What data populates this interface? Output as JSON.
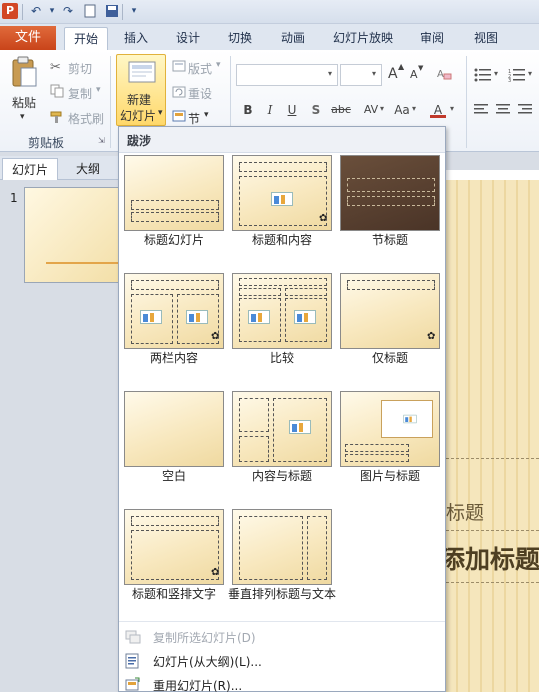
{
  "quick_access": {
    "app_icon": "P",
    "undo_icon": "undo-icon",
    "redo_icon": "redo-icon",
    "new_icon": "new-document-icon",
    "save_icon": "save-icon"
  },
  "ribbon_tabs": {
    "file": "文件",
    "tabs": [
      "开始",
      "插入",
      "设计",
      "切换",
      "动画",
      "幻灯片放映",
      "审阅",
      "视图"
    ],
    "active_index": 0
  },
  "clipboard": {
    "paste": "粘贴",
    "cut": "剪切",
    "copy": "复制",
    "format_painter": "格式刷",
    "group_label": "剪贴板"
  },
  "slides_group": {
    "new_slide_line1": "新建",
    "new_slide_line2": "幻灯片",
    "layout": "版式",
    "reset": "重设",
    "section": "节"
  },
  "font_group": {
    "bold": "B",
    "italic": "I",
    "underline": "U",
    "shadow": "S",
    "strikethrough": "abc",
    "spacing": "AV",
    "case": "Aa",
    "color": "A",
    "grow": "A",
    "shrink": "A"
  },
  "panel": {
    "tabs": [
      "幻灯片",
      "大纲"
    ],
    "slide_number": "1"
  },
  "dropdown": {
    "section_title": "跋涉",
    "layouts": [
      "标题幻灯片",
      "标题和内容",
      "节标题",
      "两栏内容",
      "比较",
      "仅标题",
      "空白",
      "内容与标题",
      "图片与标题",
      "标题和竖排文字",
      "垂直排列标题与文本"
    ],
    "menu_items": [
      {
        "label": "复制所选幻灯片(D)",
        "disabled": true
      },
      {
        "label": "幻灯片(从大纲)(L)...",
        "disabled": false
      },
      {
        "label": "重用幻灯片(R)...",
        "disabled": false
      }
    ]
  },
  "slide": {
    "title_hint": "标题",
    "add_title": "添加标题"
  },
  "colors": {
    "file_tab": "#c9441a",
    "accent_gold": "#ffd86a",
    "slide_bg": "#f5e6bc"
  }
}
